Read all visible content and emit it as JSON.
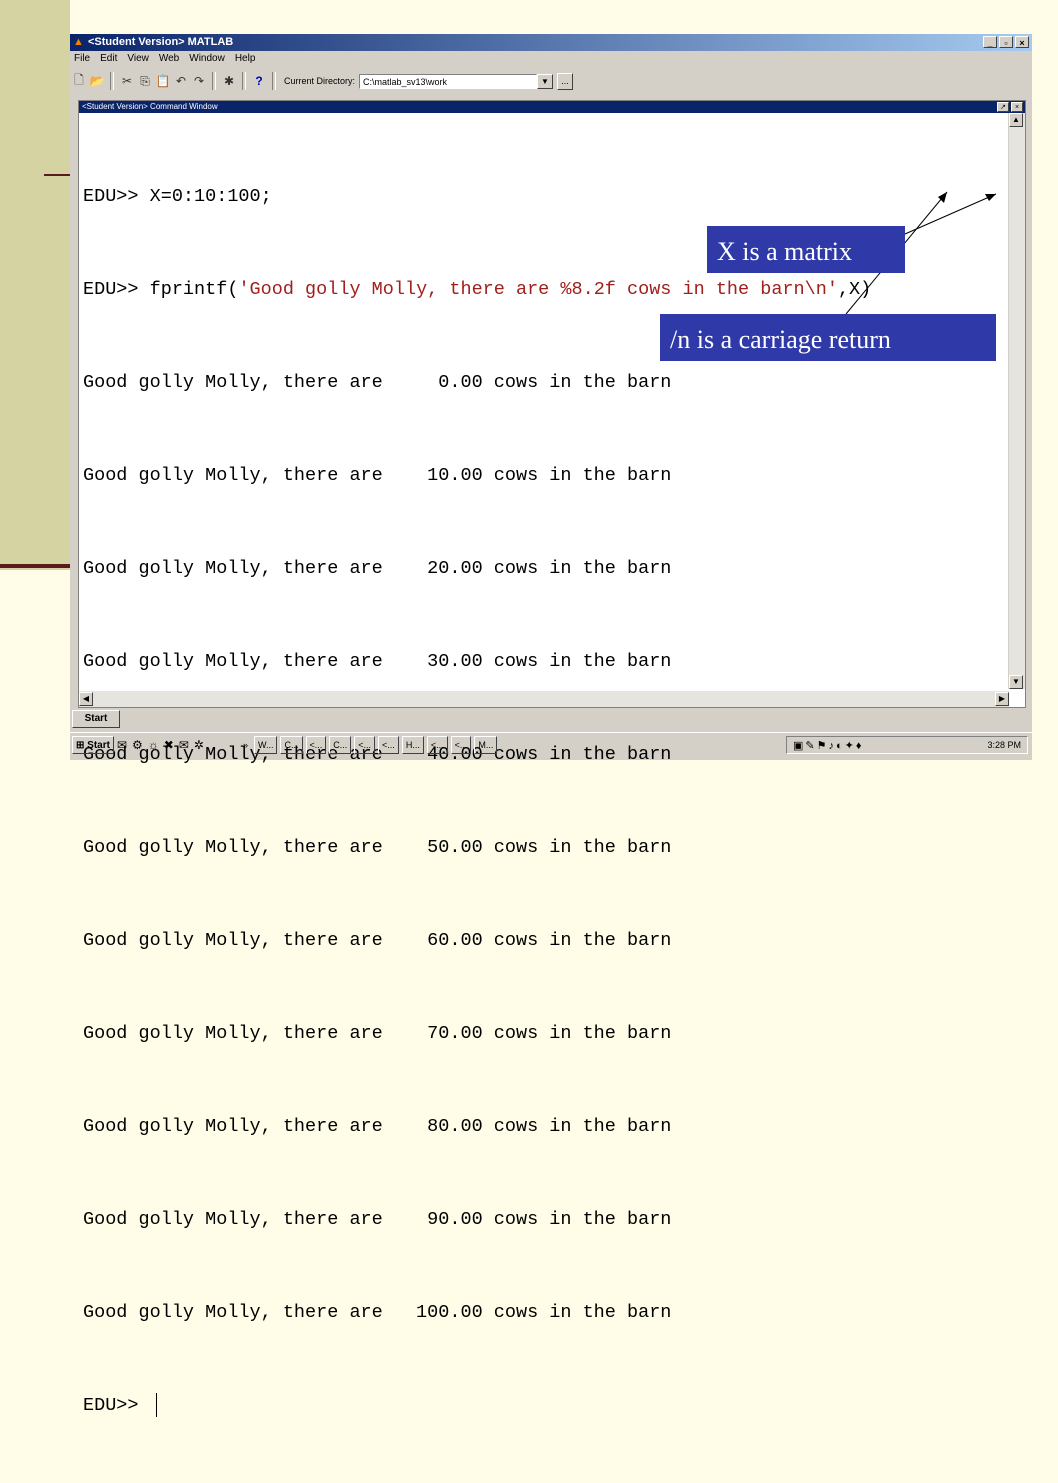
{
  "window": {
    "title": "<Student Version> MATLAB"
  },
  "menu": [
    "File",
    "Edit",
    "View",
    "Web",
    "Window",
    "Help"
  ],
  "toolbar": {
    "current_dir_label": "Current Directory:",
    "current_dir_value": "C:\\matlab_sv13\\work",
    "browse_label": "..."
  },
  "command_window": {
    "title": "<Student Version> Command Window",
    "line1": "EDU>> X=0:10:100;",
    "line2_prompt": "EDU>> fprintf(",
    "line2_string": "'Good golly Molly, there are %8.2f cows in the barn\\n'",
    "line2_tail": ",X)",
    "output": [
      "Good golly Molly, there are     0.00 cows in the barn",
      "Good golly Molly, there are    10.00 cows in the barn",
      "Good golly Molly, there are    20.00 cows in the barn",
      "Good golly Molly, there are    30.00 cows in the barn",
      "Good golly Molly, there are    40.00 cows in the barn",
      "Good golly Molly, there are    50.00 cows in the barn",
      "Good golly Molly, there are    60.00 cows in the barn",
      "Good golly Molly, there are    70.00 cows in the barn",
      "Good golly Molly, there are    80.00 cows in the barn",
      "Good golly Molly, there are    90.00 cows in the barn",
      "Good golly Molly, there are   100.00 cows in the barn"
    ],
    "prompt": "EDU>> "
  },
  "annotations": {
    "matrix": "X is a matrix",
    "newline": "/n is a carriage return"
  },
  "taskbar": {
    "start_top": "Start",
    "start": "Start",
    "tasks": [
      "W...",
      "C...",
      "<...",
      "C...",
      "<...",
      "<...",
      "H...",
      "<...",
      "<...",
      "M..."
    ],
    "clock": "3:28 PM"
  },
  "colors": {
    "string": "#a0201c",
    "annotation_bg": "#2f3aa8",
    "titlebar": "#0a246a"
  }
}
